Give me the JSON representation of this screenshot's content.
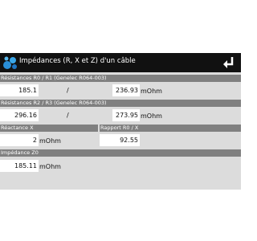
{
  "header": {
    "title": "Impédances (R, X et Z) d'un câble",
    "app_icon": "molecule-icon",
    "back_icon": "return-arrow-icon"
  },
  "sections": {
    "r0r1": {
      "label": "Résistances R0 / R1 (Genelec R064-003)",
      "value_left": "185.1",
      "separator": "/",
      "value_right": "236.93",
      "unit": "mOhm"
    },
    "r2r3": {
      "label": "Résistances R2 / R3 (Genelec R064-003)",
      "value_left": "296.16",
      "separator": "/",
      "value_right": "273.95",
      "unit": "mOhm"
    },
    "reactance": {
      "label": "Réactance X",
      "value": "2",
      "unit": "mOhm"
    },
    "ratio": {
      "label": "Rapport R0 / X",
      "value": "92.55"
    },
    "impedance": {
      "label": "Impédance Z0",
      "value": "185.11",
      "unit": "mOhm"
    }
  },
  "colors": {
    "titlebar": "#111111",
    "section_bar": "#808080",
    "background": "#dcdcdc",
    "field": "#ffffff"
  }
}
